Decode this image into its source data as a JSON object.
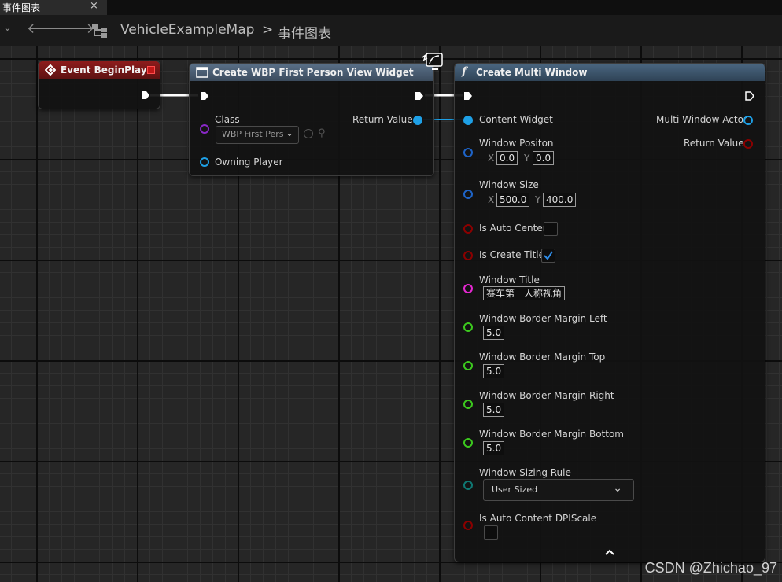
{
  "tab": {
    "title": "事件图表",
    "close": "×"
  },
  "toolbar": {
    "breadcrumb_map": "VehicleExampleMap",
    "separator": ">",
    "breadcrumb_graph": "事件图表"
  },
  "nodes": {
    "begin_play": {
      "title": "Event BeginPlay"
    },
    "create_widget": {
      "title": "Create WBP First Person View Widget",
      "class_label": "Class",
      "class_value": "WBP First Perso",
      "return_label": "Return Value",
      "owning_player_label": "Owning Player"
    },
    "create_multi_window": {
      "title": "Create Multi Window",
      "function_glyph": "f",
      "content_widget": "Content Widget",
      "multi_window_actor": "Multi Window Actor",
      "return_value": "Return Value",
      "window_position": {
        "label": "Window Positon",
        "x_label": "X",
        "x": "0.0",
        "y_label": "Y",
        "y": "0.0"
      },
      "window_size": {
        "label": "Window Size",
        "x_label": "X",
        "x": "500.0",
        "y_label": "Y",
        "y": "400.0"
      },
      "is_auto_center": {
        "label": "Is Auto Center",
        "checked": false
      },
      "is_create_title": {
        "label": "Is Create Title",
        "checked": true
      },
      "window_title": {
        "label": "Window Title",
        "value": "赛车第一人称视角"
      },
      "margin_left": {
        "label": "Window Border Margin Left",
        "value": "5.0"
      },
      "margin_top": {
        "label": "Window Border Margin Top",
        "value": "5.0"
      },
      "margin_right": {
        "label": "Window Border Margin Right",
        "value": "5.0"
      },
      "margin_bottom": {
        "label": "Window Border Margin Bottom",
        "value": "5.0"
      },
      "sizing_rule": {
        "label": "Window Sizing Rule",
        "value": "User Sized"
      },
      "auto_dpi": {
        "label": "Is Auto Content DPIScale",
        "checked": false
      }
    }
  },
  "watermark": "CSDN @Zhichao_97",
  "colors": {
    "exec": "#ffffff",
    "object_blue": "#1ea0e6",
    "class_purple": "#8a28c8",
    "struct_blue": "#1e64c8",
    "bool_red": "#8c0000",
    "string_magenta": "#e628d2",
    "float_green": "#3cc81e",
    "enum_teal": "#0f7873",
    "event_red": "#8a1a1a",
    "function_blue": "#435d75"
  }
}
